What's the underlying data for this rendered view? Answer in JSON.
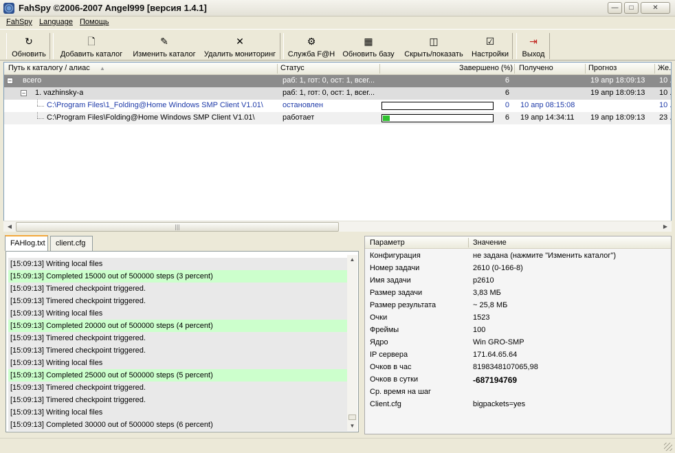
{
  "window": {
    "title": "FahSpy ©2006-2007 Angel999 [версия 1.4.1]",
    "minimize": "0",
    "maximize": "1",
    "close": "r"
  },
  "menu": [
    "FahSpy",
    "Language",
    "Помощь"
  ],
  "toolbar": [
    {
      "label": "Обновить",
      "icon": "refresh-icon",
      "glyph": "↻"
    },
    {
      "label": "Добавить каталог",
      "icon": "add-folder-icon",
      "glyph": "🗋"
    },
    {
      "label": "Изменить каталог",
      "icon": "edit-folder-icon",
      "glyph": "✎"
    },
    {
      "label": "Удалить мониторинг",
      "icon": "delete-icon",
      "glyph": "✕"
    },
    {
      "label": "Служба F@H",
      "icon": "service-icon",
      "glyph": "⚙"
    },
    {
      "label": "Обновить базу",
      "icon": "database-icon",
      "glyph": "▦"
    },
    {
      "label": "Скрыть/показать",
      "icon": "toggle-view-icon",
      "glyph": "◫"
    },
    {
      "label": "Настройки",
      "icon": "settings-icon",
      "glyph": "☑"
    },
    {
      "label": "Выход",
      "icon": "exit-icon",
      "glyph": "⇥"
    }
  ],
  "grid": {
    "columns": [
      "Путь к каталогу / алиас",
      "Статус",
      "Завершено (%)",
      "Получено",
      "Прогноз",
      "Же..."
    ],
    "rows": [
      {
        "path": "всего",
        "status": "раб: 1, гот: 0, ост: 1, всег...",
        "done": "6",
        "progress": 6,
        "received": "",
        "forecast": "19 апр 18:09:13",
        "extra": "10 ..."
      },
      {
        "path": "1. vazhinsky-a",
        "status": "раб: 1, гот: 0, ост: 1, всег...",
        "done": "6",
        "progress": 6,
        "received": "",
        "forecast": "19 апр 18:09:13",
        "extra": "10 ..."
      },
      {
        "path": "C:\\Program Files\\1_Folding@Home Windows SMP Client V1.01\\",
        "status": "остановлен",
        "done": "0",
        "progress": 0,
        "received": "10 апр  08:15:08",
        "forecast": "",
        "extra": "10 ..."
      },
      {
        "path": "C:\\Program Files\\Folding@Home Windows SMP Client V1.01\\",
        "status": "работает",
        "done": "6",
        "progress": 6,
        "received": "19 апр  14:34:11",
        "forecast": "19 апр 18:09:13",
        "extra": "23 ..."
      }
    ]
  },
  "tabs": [
    "FAHlog.txt",
    "client.cfg"
  ],
  "log": [
    {
      "text": "[15:09:13] Writing local files",
      "hl": false
    },
    {
      "text": "[15:09:13] Completed 15000 out of 500000 steps  (3 percent)",
      "hl": true
    },
    {
      "text": "[15:09:13] Timered checkpoint triggered.",
      "hl": false
    },
    {
      "text": "[15:09:13] Timered checkpoint triggered.",
      "hl": false
    },
    {
      "text": "[15:09:13] Writing local files",
      "hl": false
    },
    {
      "text": "[15:09:13] Completed 20000 out of 500000 steps  (4 percent)",
      "hl": true
    },
    {
      "text": "[15:09:13] Timered checkpoint triggered.",
      "hl": false
    },
    {
      "text": "[15:09:13] Timered checkpoint triggered.",
      "hl": false
    },
    {
      "text": "[15:09:13] Writing local files",
      "hl": false
    },
    {
      "text": "[15:09:13] Completed 25000 out of 500000 steps  (5 percent)",
      "hl": true
    },
    {
      "text": "[15:09:13] Timered checkpoint triggered.",
      "hl": false
    },
    {
      "text": "[15:09:13] Timered checkpoint triggered.",
      "hl": false
    },
    {
      "text": "[15:09:13] Writing local files",
      "hl": false
    },
    {
      "text": "[15:09:13] Completed 30000 out of 500000 steps  (6 percent)",
      "hl": false
    }
  ],
  "props": {
    "head_key": "Параметр",
    "head_value": "Значение",
    "rows": [
      {
        "k": "Конфигурация",
        "v": "не задана (нажмите \"Изменить каталог\")",
        "bold": false
      },
      {
        "k": "Номер задачи",
        "v": "2610 (0-166-8)",
        "bold": false
      },
      {
        "k": "Имя задачи",
        "v": "p2610",
        "bold": false
      },
      {
        "k": "Размер задачи",
        "v": "3,83 МБ",
        "bold": false
      },
      {
        "k": "Размер результата",
        "v": "~ 25,8 МБ",
        "bold": false
      },
      {
        "k": "Очки",
        "v": "1523",
        "bold": false
      },
      {
        "k": "Фреймы",
        "v": "100",
        "bold": false
      },
      {
        "k": "Ядро",
        "v": "Win GRO-SMP",
        "bold": false
      },
      {
        "k": "IP сервера",
        "v": "171.64.65.64",
        "bold": false
      },
      {
        "k": "Очков в час",
        "v": "8198348107065,98",
        "bold": false
      },
      {
        "k": "Очков в сутки",
        "v": "-687194769",
        "bold": true
      },
      {
        "k": "Ср. время на шаг",
        "v": "",
        "bold": false
      },
      {
        "k": "Client.cfg",
        "v": "bigpackets=yes",
        "bold": false
      }
    ]
  }
}
